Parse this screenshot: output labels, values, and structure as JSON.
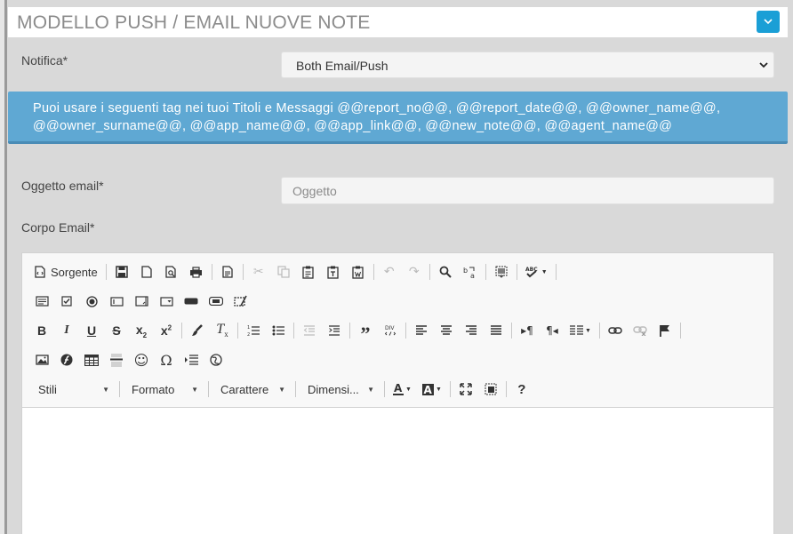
{
  "panel": {
    "title": "MODELLO PUSH / EMAIL NUOVE NOTE"
  },
  "notifica": {
    "label": "Notifica*",
    "selected": "Both Email/Push"
  },
  "info": {
    "text": "Puoi usare i seguenti tag nei tuoi Titoli e Messaggi @@report_no@@, @@report_date@@, @@owner_name@@, @@owner_surname@@, @@app_name@@, @@app_link@@, @@new_note@@, @@agent_name@@"
  },
  "oggetto": {
    "label": "Oggetto email*",
    "placeholder": "Oggetto"
  },
  "corpo": {
    "label": "Corpo Email*"
  },
  "toolbar": {
    "source_label": "Sorgente",
    "combos": {
      "styles": "Stili",
      "format": "Formato",
      "font": "Carattere",
      "size": "Dimensi..."
    },
    "help_label": "?"
  },
  "colors": {
    "accent": "#1a9fd6",
    "info_bg": "#5fa8d3",
    "page_bg": "#d9d9d9"
  }
}
